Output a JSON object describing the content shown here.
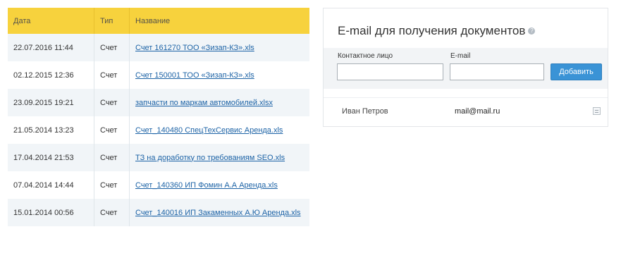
{
  "documents": {
    "headers": {
      "date": "Дата",
      "type": "Тип",
      "name": "Название"
    },
    "rows": [
      {
        "date": "22.07.2016 11:44",
        "type": "Счет",
        "name": "Счет 161270 ТОО «Зизап-КЗ».xls"
      },
      {
        "date": "02.12.2015 12:36",
        "type": "Счет",
        "name": "Счет 150001 ТОО «Зизап-КЗ».xls"
      },
      {
        "date": "23.09.2015 19:21",
        "type": "Счет",
        "name": "запчасти по маркам автомобилей.xlsx"
      },
      {
        "date": "21.05.2014 13:23",
        "type": "Счет",
        "name": "Счет_140480 СпецТехСервис Аренда.xls"
      },
      {
        "date": "17.04.2014 21:53",
        "type": "Счет",
        "name": "ТЗ на доработку по требованиям SEO.xls"
      },
      {
        "date": "07.04.2014 14:44",
        "type": "Счет",
        "name": "Счет_140360 ИП Фомин А.А Аренда.xls"
      },
      {
        "date": "15.01.2014 00:56",
        "type": "Счет",
        "name": "Счет_140016 ИП Закаменных А.Ю Аренда.xls"
      }
    ]
  },
  "email_panel": {
    "title": "E-mail для получения документов",
    "help_icon": "?",
    "contact_label": "Контактное лицо",
    "contact_value": "",
    "email_label": "E-mail",
    "email_value": "",
    "add_button": "Добавить",
    "contacts": [
      {
        "name": "Иван Петров",
        "email": "mail@mail.ru",
        "icon": "edit-icon"
      }
    ]
  },
  "colors": {
    "header_bg": "#f7d23d",
    "row_alt": "#f1f5f8",
    "link": "#1d63a6",
    "button": "#3a93d6"
  }
}
